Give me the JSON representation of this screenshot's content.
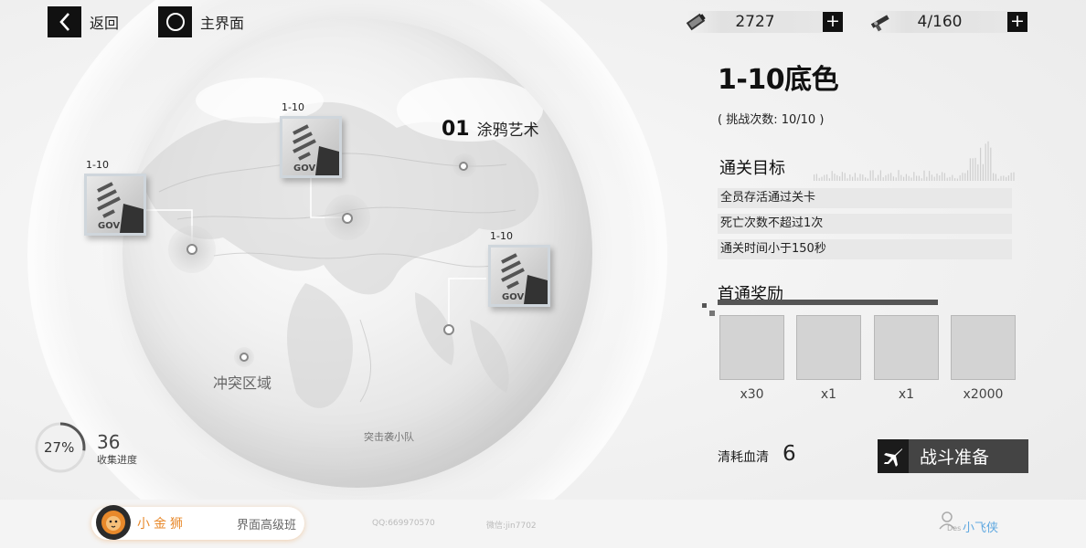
{
  "nav": {
    "back_label": "返回",
    "home_label": "主界面"
  },
  "resources": [
    {
      "icon": "fuel-canister-icon",
      "value": "2727"
    },
    {
      "icon": "gun-icon",
      "value": "4/160"
    }
  ],
  "map": {
    "region_label": "冲突区域",
    "squad_label": "突击袭小队",
    "chapter_num": "01",
    "chapter_name": "涂鸦艺术",
    "levels": [
      {
        "label": "1-10",
        "thumb_text": "GOV"
      },
      {
        "label": "1-10",
        "thumb_text": "GOV"
      },
      {
        "label": "1-10",
        "thumb_text": "GOV"
      }
    ]
  },
  "progress": {
    "percent_label": "27%",
    "percent": 27,
    "count": "36",
    "caption": "收集进度"
  },
  "stage": {
    "title": "1-10底色",
    "attempts": "( 挑战次数: 10/10 )",
    "objectives_title": "通关目标",
    "objectives": [
      "全员存活通过关卡",
      "死亡次数不超过1次",
      "通关时间小于150秒"
    ],
    "rewards_title": "首通奖励",
    "rewards": [
      "x30",
      "x1",
      "x1",
      "x2000"
    ],
    "cost_label": "清耗血清",
    "cost_value": "6",
    "battle_label": "战斗准备"
  },
  "footer": {
    "brand_name": "小金狮",
    "brand_course": "界面高级班",
    "qq": "QQ:669970570",
    "wechat": "微信:jin7702",
    "author": "小飞侠",
    "author_tag": "Des"
  },
  "colors": {
    "accent_orange": "#e8892b",
    "dark": "#111111",
    "footer_blue": "#5fa8e0"
  }
}
